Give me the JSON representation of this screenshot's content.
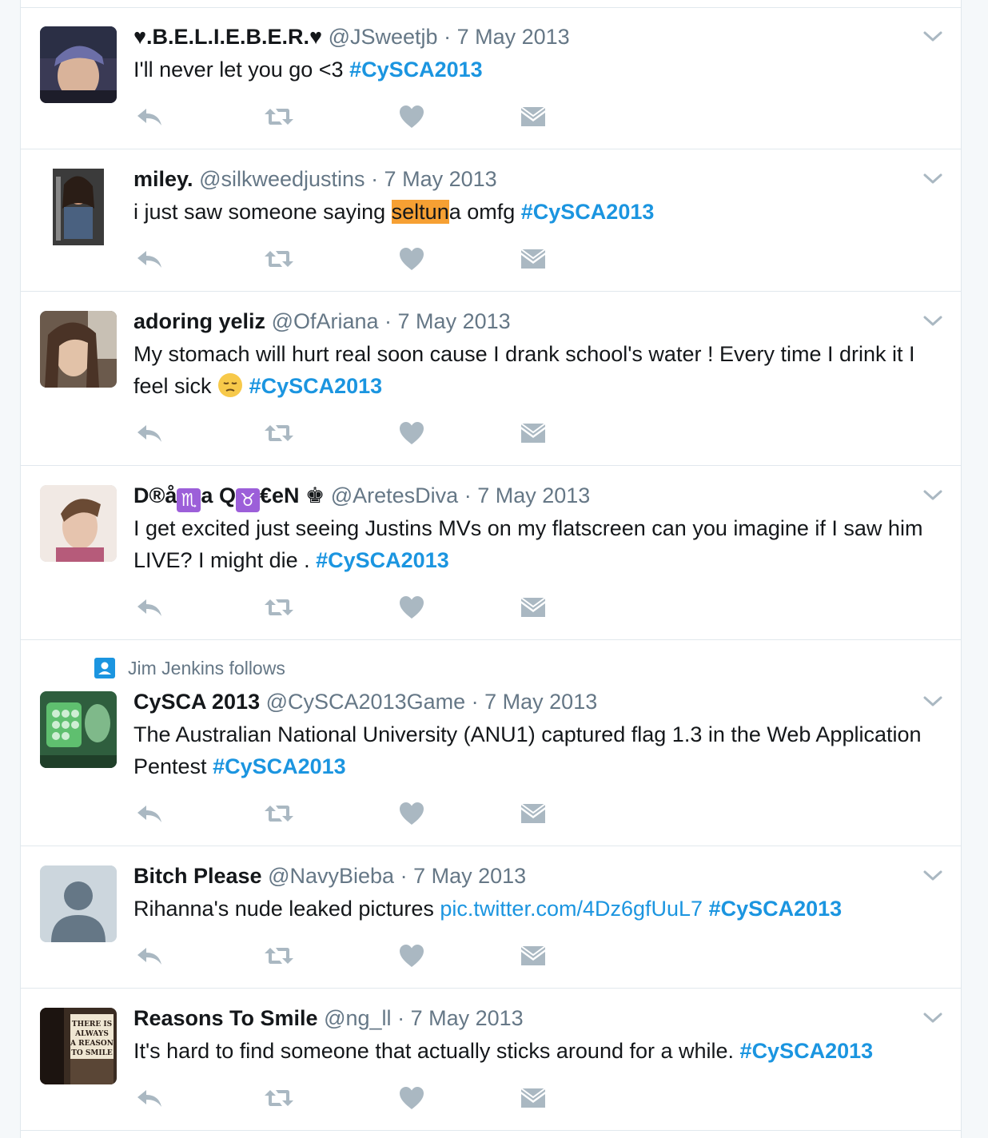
{
  "colors": {
    "accent": "#1b95e0",
    "meta_text": "#657786",
    "action_icon": "#aab8c2",
    "highlight": "#f6a033",
    "divider": "#e1e8ed"
  },
  "icons": {
    "reply": "reply-icon",
    "retweet": "retweet-icon",
    "like": "heart-icon",
    "message": "envelope-icon",
    "more": "chevron-down-icon",
    "follows": "person-icon"
  },
  "tweets": [
    {
      "name": "♥.B.E.L.I.E.B.E.R.♥",
      "handle": "@JSweetjb",
      "date": "· 7 May 2013",
      "text": "I'll never let you go <3 ",
      "hashtag": "#CySCA2013"
    },
    {
      "name": "miley.",
      "handle": "@silkweedjustins",
      "date": "· 7 May 2013",
      "text_before": "i just saw someone saying ",
      "highlight": "seltun",
      "text_after": "a omfg ",
      "hashtag": "#CySCA2013"
    },
    {
      "name": "adoring yeliz",
      "handle": "@OfAriana",
      "date": "· 7 May 2013",
      "text": "My stomach will hurt real soon cause I drank school's water ! Every time I drink it I feel sick ",
      "hashtag": "#CySCA2013"
    },
    {
      "name_part1": "D®å",
      "name_glyph1": "♏",
      "name_part2": "a Q",
      "name_glyph2": "♉",
      "name_part3": "€eN ♚",
      "handle": "@AretesDiva",
      "date": "· 7 May 2013",
      "text": "I get excited just seeing Justins MVs on my flatscreen can you imagine if I saw him LIVE? I might die . ",
      "hashtag": "#CySCA2013"
    },
    {
      "context": "Jim Jenkins follows",
      "name": "CySCA 2013",
      "handle": "@CySCA2013Game",
      "date": "· 7 May 2013",
      "text": "The Australian National University (ANU1) captured flag 1.3 in the Web Application Pentest ",
      "hashtag": "#CySCA2013"
    },
    {
      "name": "Bitch Please",
      "handle": "@NavyBieba",
      "date": "· 7 May 2013",
      "text": "Rihanna's nude leaked pictures ",
      "link": "pic.twitter.com/4Dz6gfUuL7",
      "hashtag": "#CySCA2013"
    },
    {
      "name": "Reasons To Smile",
      "handle": "@ng_ll",
      "date": "· 7 May 2013",
      "text": "It's hard to find someone that actually sticks around for a while. ",
      "hashtag": "#CySCA2013",
      "avatar_sign": [
        "THERE IS",
        "ALWAYS",
        "A REASON",
        "TO SMILE"
      ]
    }
  ]
}
